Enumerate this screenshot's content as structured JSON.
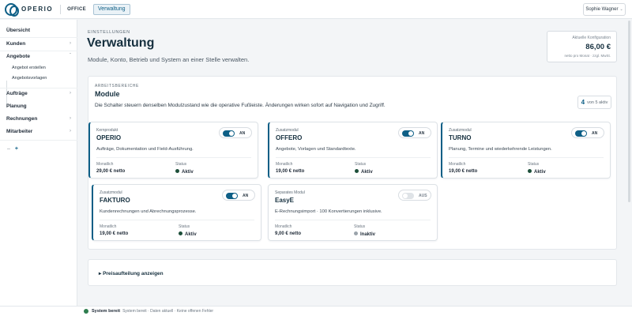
{
  "topbar": {
    "brand": "OPERIO",
    "section": "OFFICE",
    "active_tab": "Verwaltung",
    "user": "Sophie Wagner"
  },
  "sidebar": {
    "items": [
      {
        "label": "Übersicht"
      },
      {
        "label": "Kunden"
      },
      {
        "label": "Angebote",
        "expanded": true,
        "children": [
          "Angebot erstellen",
          "Angebotsvorlagen"
        ]
      },
      {
        "label": "Aufträge"
      },
      {
        "label": "Planung"
      },
      {
        "label": "Rechnungen"
      },
      {
        "label": "Mitarbeiter"
      }
    ],
    "extra": {
      "minus": "–",
      "plus": "+"
    }
  },
  "header": {
    "eyebrow": "EINSTELLUNGEN",
    "title": "Verwaltung",
    "subtitle": "Module, Konto, Betrieb und System an einer Stelle verwalten."
  },
  "config": {
    "label": "Aktuelle Konfiguration",
    "value": "86,00 €",
    "note": "netto pro Monat · zzgl. MwSt."
  },
  "modules": {
    "eyebrow": "ARBEITSBEREICHE",
    "title": "Module",
    "description": "Die Schalter steuern denselben Modulzustand wie die operative Fußleiste. Änderungen wirken sofort auf Navigation und Zugriff.",
    "count_active": "4",
    "count_text": "von 5 aktiv",
    "monthly_label": "Monatlich",
    "status_label": "Status",
    "cards": [
      {
        "type": "Kernprodukt",
        "name": "OPERIO",
        "desc": "Aufträge, Dokumentation und Field-Ausführung.",
        "price": "29,00 € netto",
        "status": "Aktiv",
        "toggle": "AN",
        "on": true
      },
      {
        "type": "Zusatzmodul",
        "name": "OFFERO",
        "desc": "Angebote, Vorlagen und Standardtexte.",
        "price": "19,00 € netto",
        "status": "Aktiv",
        "toggle": "AN",
        "on": true
      },
      {
        "type": "Zusatzmodul",
        "name": "TURNO",
        "desc": "Planung, Termine und wiederkehrende Leistungen.",
        "price": "19,00 € netto",
        "status": "Aktiv",
        "toggle": "AN",
        "on": true
      },
      {
        "type": "Zusatzmodul",
        "name": "FAKTURO",
        "desc": "Kundenrechnungen und Abrechnungsprozesse.",
        "price": "19,00 € netto",
        "status": "Aktiv",
        "toggle": "AN",
        "on": true
      },
      {
        "type": "Separates Modul",
        "name": "EasyE",
        "desc": "E-Rechnungsimport · 100 Konvertierungen inklusive.",
        "price": "9,00 € netto",
        "status": "Inaktiv",
        "toggle": "AUS",
        "on": false
      }
    ]
  },
  "price_breakdown": {
    "label": "▸ Preisaufteilung anzeigen"
  },
  "statusbar": {
    "main": "System bereit",
    "detail": "System bereit · Daten aktuell · Keine offenen Fehler"
  },
  "colors": {
    "accent": "#0e5f86",
    "active_dot": "#1d4f3a",
    "inactive_dot": "#9aa3ab",
    "ok": "#2e7d4f"
  }
}
